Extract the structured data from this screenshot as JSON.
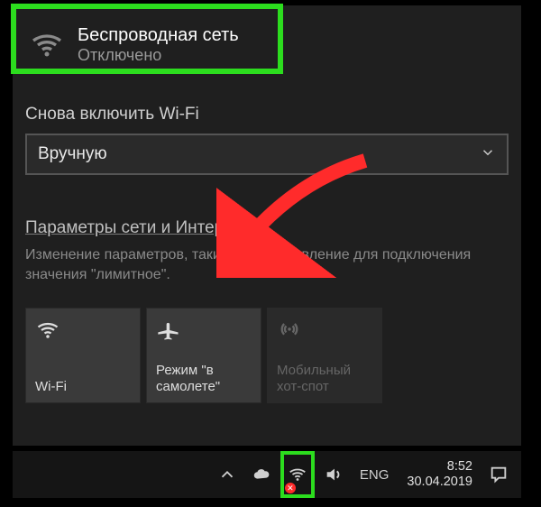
{
  "header": {
    "title": "Беспроводная сеть",
    "status": "Отключено"
  },
  "reconnect_label": "Снова включить Wi-Fi",
  "dropdown": {
    "selected": "Вручную"
  },
  "settings": {
    "link": "Параметры сети и Интернет",
    "desc": "Изменение параметров, таких как установление для подключения значения \"лимитное\"."
  },
  "tiles": {
    "wifi": "Wi-Fi",
    "airplane": "Режим \"в самолете\"",
    "hotspot": "Мобильный хот-спот"
  },
  "taskbar": {
    "lang": "ENG",
    "time": "8:52",
    "date": "30.04.2019"
  }
}
